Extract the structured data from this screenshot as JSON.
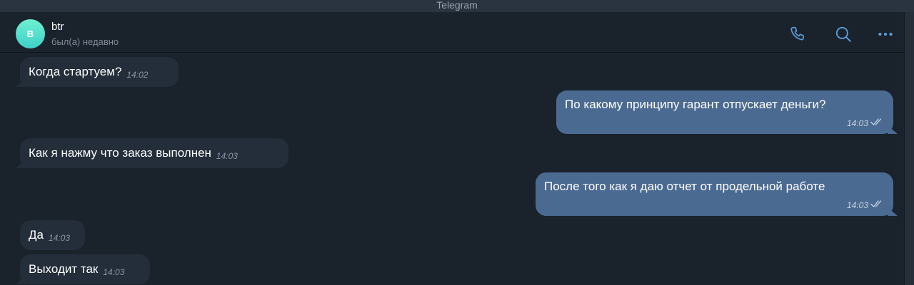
{
  "window": {
    "title": "Telegram"
  },
  "header": {
    "avatar_letter": "B",
    "name": "btr",
    "status": "был(а) недавно",
    "icons": [
      "phone-icon",
      "search-icon",
      "more-icon"
    ]
  },
  "colors": {
    "background": "#1a222c",
    "incoming_bubble": "#242e3a",
    "outgoing_bubble": "#4b6a91",
    "accent": "#5b9bd5"
  },
  "messages": [
    {
      "direction": "in",
      "text": "Когда стартуем?",
      "time": "14:02"
    },
    {
      "direction": "out",
      "text": "По какому принципу гарант отпускает деньги?",
      "time": "14:03",
      "read": true
    },
    {
      "direction": "in",
      "text": "Как я нажму что заказ выполнен",
      "time": "14:03"
    },
    {
      "direction": "out",
      "text": "После того как я даю отчет от продельной работе",
      "time": "14:03",
      "read": true
    },
    {
      "direction": "in",
      "text": "Да",
      "time": "14:03"
    },
    {
      "direction": "in",
      "text": "Выходит так",
      "time": "14:03"
    }
  ]
}
